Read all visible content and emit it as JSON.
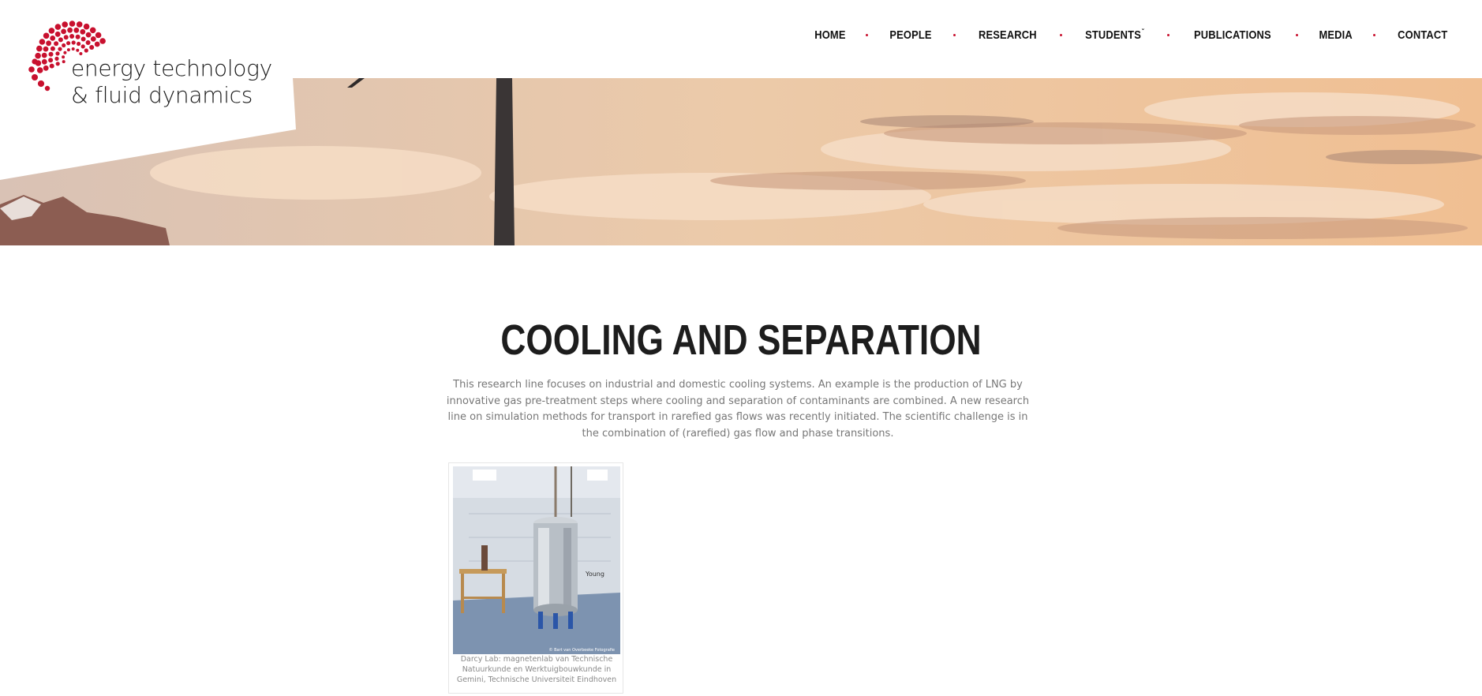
{
  "brand": {
    "line1": "energy technology",
    "line2": "& fluid dynamics",
    "accent_color": "#c8102e"
  },
  "nav": {
    "items": [
      {
        "label": "HOME"
      },
      {
        "label": "PEOPLE"
      },
      {
        "label": "RESEARCH"
      },
      {
        "label": "STUDENTS",
        "has_dropdown": true
      },
      {
        "label": "PUBLICATIONS"
      },
      {
        "label": "MEDIA"
      },
      {
        "label": "CONTACT"
      }
    ],
    "dropdown_icon": "chevron-down-icon"
  },
  "hero": {
    "description_icon": "sunset-wind-turbine-banner"
  },
  "page": {
    "title": "COOLING AND SEPARATION",
    "intro": "This research line focuses on industrial and domestic cooling systems. An example is the production of LNG by innovative gas pre-treatment steps where cooling and separation of contaminants are combined. A new research line on simulation methods for transport in rarefied gas flows was recently initiated. The scientific challenge is in the combination of (rarefied) gas flow and phase transitions."
  },
  "figure": {
    "caption": "Darcy Lab: magnetenlab van Technische Natuurkunde en Werktuigbouwkunde  in Gemini, Technische Universiteit Eindhoven",
    "photo_watermark": "© Bart van Overbeeke Fotografie",
    "photo_sign": "Young"
  }
}
